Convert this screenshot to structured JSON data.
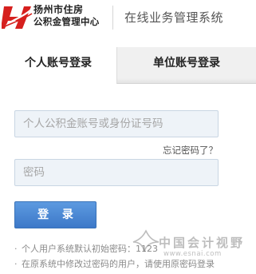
{
  "header": {
    "logo_icon": "housing-fund-logo",
    "logo_line1": "扬州市住房",
    "logo_line2": "公积金管理中心",
    "system_title": "在线业务管理系统"
  },
  "tabs": [
    {
      "label": "个人账号登录",
      "active": true
    },
    {
      "label": "单位账号登录",
      "active": false
    }
  ],
  "form": {
    "account_placeholder": "个人公积金账号或身份证号码",
    "password_placeholder": "密码",
    "forgot_label": "忘记密码了？",
    "login_label": "登 录"
  },
  "notes": [
    "个人用户系统默认初始密码：1123",
    "在原系统中修改过密码的用户，请使用原密码登录"
  ],
  "watermark": {
    "icon": "chinaacc-watermark-logo",
    "text": "中国会计视野",
    "subtext": "www.esnai.com"
  },
  "colors": {
    "logo_red": "#d6201e",
    "button_blue": "#4a86d4",
    "field_bg": "#eef3f8",
    "inactive_tab_bg": "#f0f0f0"
  }
}
